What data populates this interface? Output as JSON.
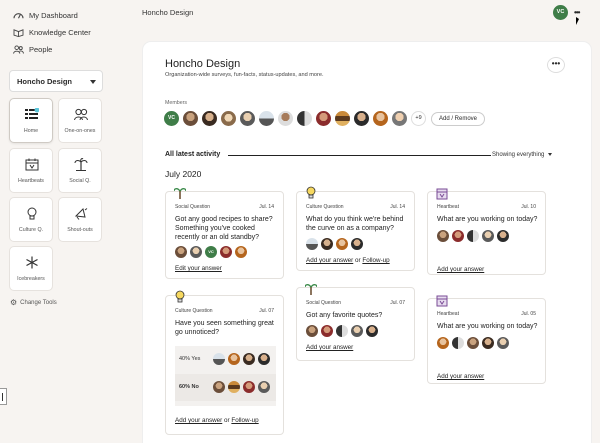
{
  "nav": {
    "items": [
      {
        "label": "My Dashboard",
        "icon": "dashboard-icon"
      },
      {
        "label": "Knowledge Center",
        "icon": "book-icon"
      },
      {
        "label": "People",
        "icon": "people-icon"
      }
    ],
    "workspace": "Honcho Design",
    "tools": [
      {
        "label": "Home",
        "icon": "home-list-icon",
        "active": true
      },
      {
        "label": "One-on-ones",
        "icon": "one-on-ones-icon",
        "active": false
      },
      {
        "label": "Heartbeats",
        "icon": "calendar-icon",
        "active": false
      },
      {
        "label": "Social Q.",
        "icon": "palm-tree-icon",
        "active": false
      },
      {
        "label": "Culture Q.",
        "icon": "lightbulb-icon",
        "active": false
      },
      {
        "label": "Shout-outs",
        "icon": "megaphone-icon",
        "active": false
      },
      {
        "label": "Icebreakers",
        "icon": "snowflake-icon",
        "active": false
      }
    ],
    "change_tools": "Change Tools"
  },
  "header": {
    "title": "Honcho Design",
    "avatar": "VC",
    "more": "•••"
  },
  "panel": {
    "title": "Honcho Design",
    "subtitle": "Organization-wide surveys, fun-facts, status-updates, and more.",
    "more": "•••",
    "members_label": "Members",
    "member_initials": "VC",
    "member_more": "+9",
    "add_remove": "Add / Remove",
    "activity_label": "All latest activity",
    "filter": "Showing everything",
    "month": "July 2020"
  },
  "cards": [
    {
      "type": "Social Question",
      "date": "Jul. 14",
      "question": "Got any good recipes to share? Something you've cooked recently or an old standby?",
      "action": "Edit your answer"
    },
    {
      "type": "Culture Question",
      "date": "Jul. 14",
      "question": "What do you think we're behind the curve on as a company?",
      "action": "Add your answer",
      "sep": "or",
      "action2": "Follow-up"
    },
    {
      "type": "Heartbeat",
      "date": "Jul. 10",
      "question": "What are you working on today?",
      "action": "Add your answer"
    },
    {
      "type": "Culture Question",
      "date": "Jul. 07",
      "question": "Have you seen something great go unnoticed?",
      "poll": [
        {
          "label": "40% Yes"
        },
        {
          "label": "60% No"
        }
      ],
      "poll_values": [
        40,
        60
      ],
      "action": "Add your answer",
      "sep": "or",
      "action2": "Follow-up"
    },
    {
      "type": "Social Question",
      "date": "Jul. 07",
      "question": "Got any favorite quotes?",
      "action": "Add your answer"
    },
    {
      "type": "Heartbeat",
      "date": "Jul. 05",
      "question": "What are you working on today?",
      "action": "Add your answer"
    }
  ],
  "colors": {
    "accent": "#3f7d48",
    "background": "#f7f4f1"
  }
}
